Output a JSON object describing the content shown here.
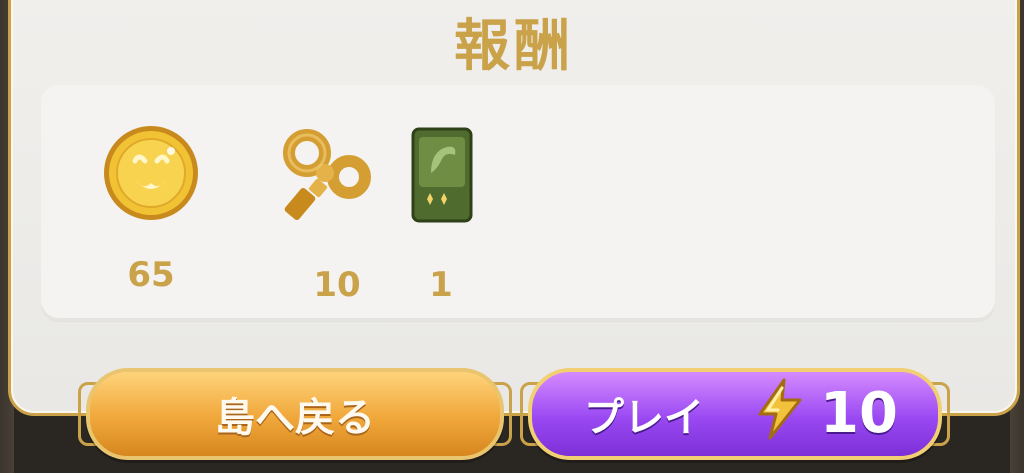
{
  "header": {
    "title": "報酬"
  },
  "rewards": [
    {
      "icon": "gold-coin-icon",
      "count": "65"
    },
    {
      "icon": "wind-up-key-icon",
      "count": "10"
    },
    {
      "icon": "green-card-pack-icon",
      "count": "1"
    }
  ],
  "buttons": {
    "back_label": "島へ戻る",
    "play_label": "プレイ",
    "play_cost": "10"
  },
  "colors": {
    "gold_text": "#c9a24a",
    "panel_bg": "#eeece9",
    "back_button": "#f0a73a",
    "play_button": "#9a49f2"
  }
}
